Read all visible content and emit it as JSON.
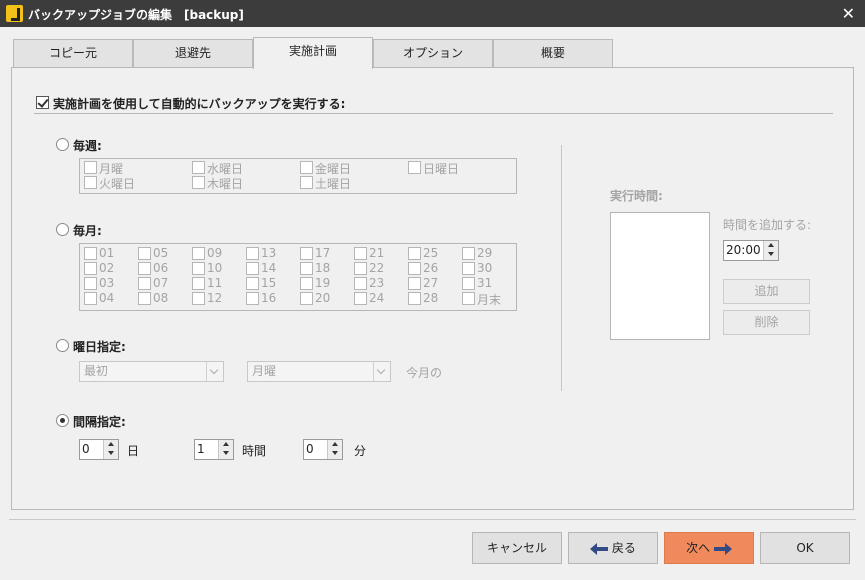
{
  "window": {
    "title": "バックアップジョブの編集　[backup]"
  },
  "tabs": [
    {
      "label": "コピー元"
    },
    {
      "label": "退避先"
    },
    {
      "label": "実施計画"
    },
    {
      "label": "オプション"
    },
    {
      "label": "概要"
    }
  ],
  "schedule": {
    "enable_label": "実施計画を使用して自動的にバックアップを実行する:",
    "enable_checked": true,
    "weekly": {
      "label": "毎週:",
      "days": [
        "月曜",
        "水曜日",
        "金曜日",
        "日曜日",
        "火曜日",
        "木曜日",
        "土曜日"
      ]
    },
    "monthly": {
      "label": "毎月:",
      "days": [
        "01",
        "05",
        "09",
        "13",
        "17",
        "21",
        "25",
        "29",
        "02",
        "06",
        "10",
        "14",
        "18",
        "22",
        "26",
        "30",
        "03",
        "07",
        "11",
        "15",
        "19",
        "23",
        "27",
        "31",
        "04",
        "08",
        "12",
        "16",
        "20",
        "24",
        "28",
        "月末"
      ]
    },
    "weekday": {
      "label": "曜日指定:",
      "ordinal_value": "最初",
      "day_value": "月曜",
      "suffix": "今月の"
    },
    "interval": {
      "label": "間隔指定:",
      "selected": true,
      "days_value": "0",
      "days_unit": "日",
      "hours_value": "1",
      "hours_unit": "時間",
      "minutes_value": "0",
      "minutes_unit": "分"
    },
    "run_time": {
      "label": "実行時間:",
      "add_label": "時間を追加する:",
      "time_value": "20:00",
      "add_button": "追加",
      "delete_button": "削除"
    }
  },
  "footer": {
    "cancel": "キャンセル",
    "back": "戻る",
    "next": "次へ",
    "ok": "OK"
  }
}
